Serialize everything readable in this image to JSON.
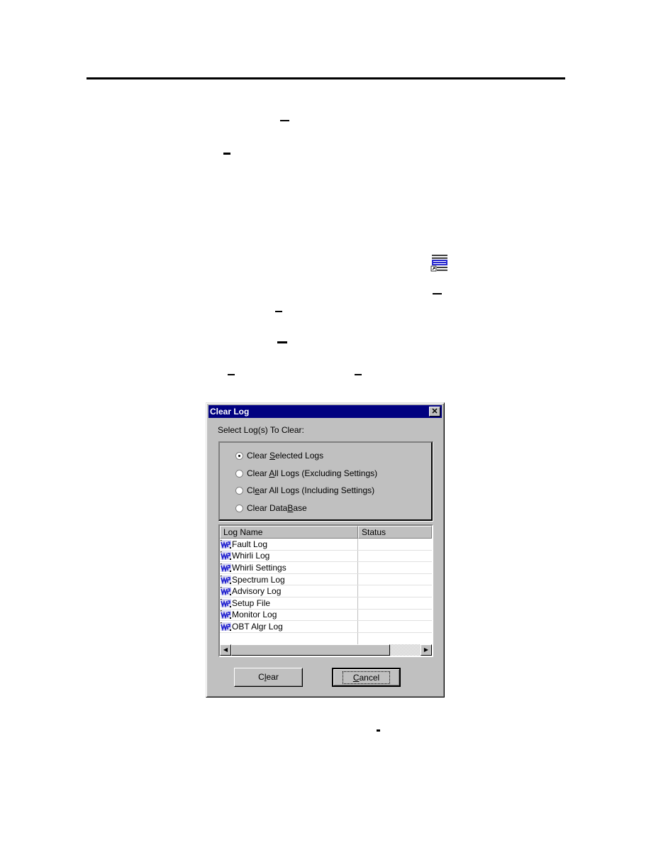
{
  "dialog": {
    "title": "Clear Log",
    "close_icon": "close-icon",
    "prompt": "Select Log(s) To Clear:",
    "options": [
      {
        "pre": "Clear ",
        "key": "S",
        "post": "elected Logs",
        "selected": true
      },
      {
        "pre": "Clear ",
        "key": "A",
        "post": "ll Logs (Excluding Settings)",
        "selected": false
      },
      {
        "pre": "Cl",
        "key": "e",
        "post": "ar All Logs (Including Settings)",
        "selected": false
      },
      {
        "pre": "Clear Data",
        "key": "B",
        "post": "ase",
        "selected": false
      }
    ],
    "columns": [
      "Log Name",
      "Status"
    ],
    "rows": [
      {
        "name": "Fault Log",
        "status": ""
      },
      {
        "name": "Whirli Log",
        "status": ""
      },
      {
        "name": "Whirli Settings",
        "status": ""
      },
      {
        "name": "Spectrum Log",
        "status": ""
      },
      {
        "name": "Advisory Log",
        "status": ""
      },
      {
        "name": "Setup File",
        "status": ""
      },
      {
        "name": "Monitor Log",
        "status": ""
      },
      {
        "name": "OBT Algr Log",
        "status": ""
      }
    ],
    "row_icon": "log-file-icon",
    "hscroll_thumb_fraction": 0.84,
    "clear_button": {
      "pre": "C",
      "key": "l",
      "post": "ear"
    },
    "cancel_button": {
      "pre": "",
      "key": "C",
      "post": "ancel"
    }
  },
  "page": {
    "shortcut_icon": "log-shortcut-icon"
  }
}
